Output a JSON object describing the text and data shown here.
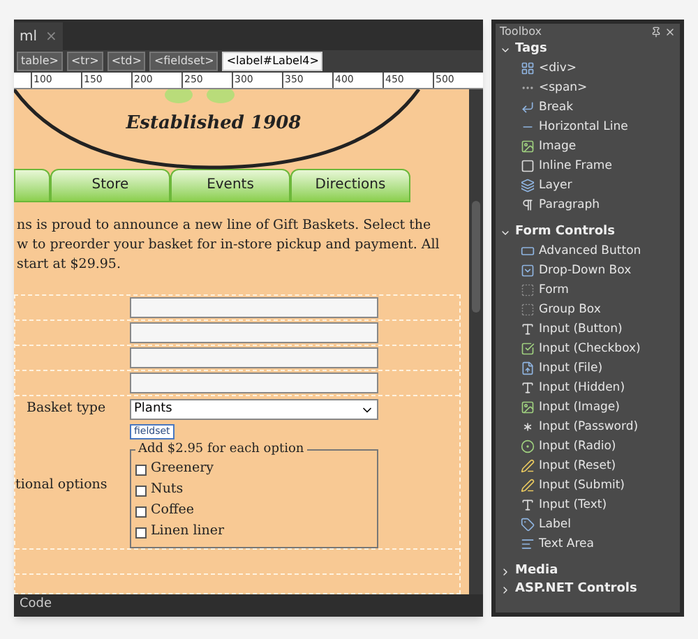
{
  "editor": {
    "document_tab": {
      "label": "ml",
      "close": "×"
    },
    "breadcrumb": [
      {
        "label": "table>",
        "selected": false
      },
      {
        "label": "<tr>",
        "selected": false
      },
      {
        "label": "<td>",
        "selected": false
      },
      {
        "label": "<fieldset>",
        "selected": false
      },
      {
        "label": "<label#Label4>",
        "selected": true
      }
    ],
    "ruler_ticks": [
      "100",
      "150",
      "200",
      "250",
      "300",
      "350",
      "400",
      "450",
      "500"
    ],
    "tagline": "Established 1908",
    "nav_tabs": [
      "Store",
      "Events",
      "Directions"
    ],
    "intro_lines": [
      "ns is proud to announce a new line of Gift Baskets. Select the",
      "w to preorder your basket for in-store pickup and payment. All",
      "start at $29.95."
    ],
    "form": {
      "basket": {
        "label": "Basket type",
        "value": "Plants"
      },
      "options": {
        "label": "tional options",
        "tag": "fieldset",
        "legend": "Add $2.95 for each option",
        "items": [
          {
            "label": "Greenery",
            "checked": false
          },
          {
            "label": "Nuts",
            "checked": false
          },
          {
            "label": "Coffee",
            "checked": false
          },
          {
            "label": "Linen liner",
            "checked": false
          }
        ]
      }
    },
    "view_tab": "Code"
  },
  "toolbox": {
    "title": "Toolbox",
    "groups": [
      {
        "label": "Tags",
        "expanded": true,
        "items": [
          "<div>",
          "<span>",
          "Break",
          "Horizontal Line",
          "Image",
          "Inline Frame",
          "Layer",
          "Paragraph"
        ]
      },
      {
        "label": "Form Controls",
        "expanded": true,
        "items": [
          "Advanced Button",
          "Drop-Down Box",
          "Form",
          "Group Box",
          "Input (Button)",
          "Input (Checkbox)",
          "Input (File)",
          "Input (Hidden)",
          "Input (Image)",
          "Input (Password)",
          "Input (Radio)",
          "Input (Reset)",
          "Input (Submit)",
          "Input (Text)",
          "Label",
          "Text Area"
        ]
      },
      {
        "label": "Media",
        "expanded": false
      },
      {
        "label": "ASP.NET Controls",
        "expanded": false
      }
    ]
  }
}
